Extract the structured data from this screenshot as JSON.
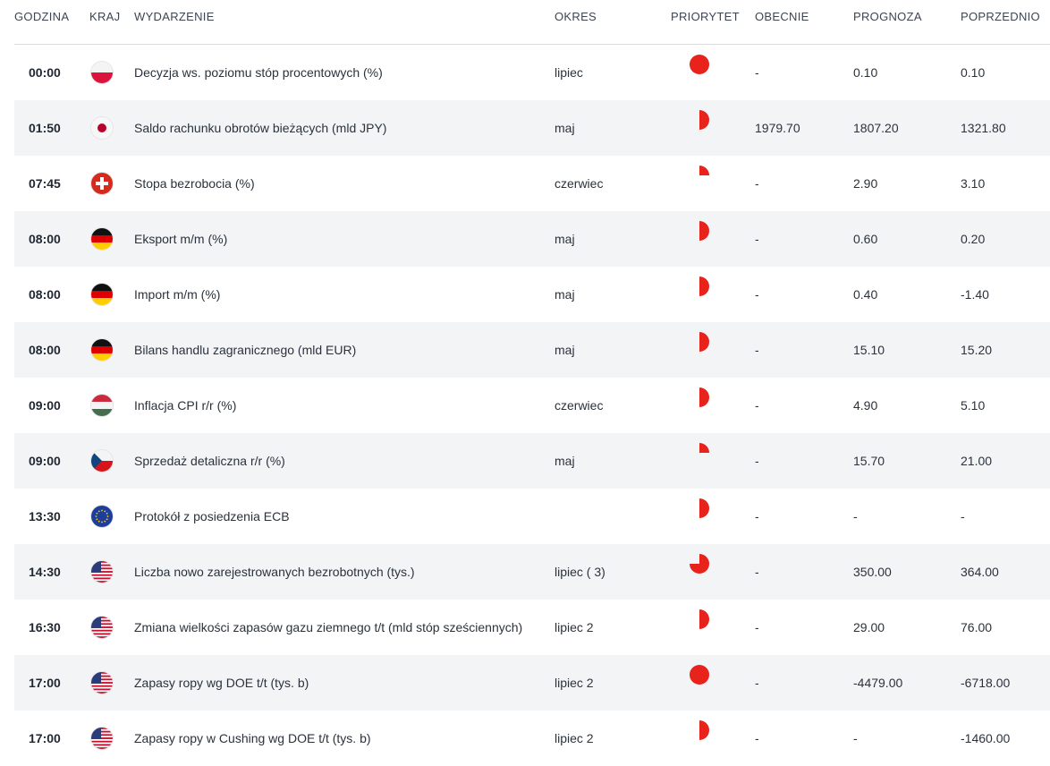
{
  "headers": {
    "time": "GODZINA",
    "country": "KRAJ",
    "event": "WYDARZENIE",
    "period": "OKRES",
    "priority": "PRIORYTET",
    "actual": "OBECNIE",
    "forecast": "PROGNOZA",
    "previous": "POPRZEDNIO"
  },
  "colors": {
    "priority": "#e8231c",
    "row_alt_bg": "#f3f4f6",
    "divider": "#d8dce2"
  },
  "rows": [
    {
      "time": "00:00",
      "country": "flag-poland-icon",
      "event": "Decyzja ws. poziomu stóp procentowych (%)",
      "period": "lipiec",
      "priority": "full",
      "actual": "-",
      "forecast": "0.10",
      "previous": "0.10"
    },
    {
      "time": "01:50",
      "country": "flag-japan-icon",
      "event": "Saldo rachunku obrotów bieżących (mld JPY)",
      "period": "maj",
      "priority": "half",
      "actual": "1979.70",
      "forecast": "1807.20",
      "previous": "1321.80"
    },
    {
      "time": "07:45",
      "country": "flag-switzerland-icon",
      "event": "Stopa bezrobocia (%)",
      "period": "czerwiec",
      "priority": "quarter",
      "actual": "-",
      "forecast": "2.90",
      "previous": "3.10"
    },
    {
      "time": "08:00",
      "country": "flag-germany-icon",
      "event": "Eksport m/m (%)",
      "period": "maj",
      "priority": "half",
      "actual": "-",
      "forecast": "0.60",
      "previous": "0.20"
    },
    {
      "time": "08:00",
      "country": "flag-germany-icon",
      "event": "Import m/m (%)",
      "period": "maj",
      "priority": "half",
      "actual": "-",
      "forecast": "0.40",
      "previous": "-1.40"
    },
    {
      "time": "08:00",
      "country": "flag-germany-icon",
      "event": "Bilans handlu zagranicznego (mld EUR)",
      "period": "maj",
      "priority": "half",
      "actual": "-",
      "forecast": "15.10",
      "previous": "15.20"
    },
    {
      "time": "09:00",
      "country": "flag-hungary-icon",
      "event": "Inflacja CPI r/r (%)",
      "period": "czerwiec",
      "priority": "half",
      "actual": "-",
      "forecast": "4.90",
      "previous": "5.10"
    },
    {
      "time": "09:00",
      "country": "flag-czechia-icon",
      "event": "Sprzedaż detaliczna r/r (%)",
      "period": "maj",
      "priority": "quarter",
      "actual": "-",
      "forecast": "15.70",
      "previous": "21.00"
    },
    {
      "time": "13:30",
      "country": "flag-eu-icon",
      "event": "Protokół z posiedzenia ECB",
      "period": "",
      "priority": "half",
      "actual": "-",
      "forecast": "-",
      "previous": "-"
    },
    {
      "time": "14:30",
      "country": "flag-usa-icon",
      "event": "Liczba nowo zarejestrowanych bezrobotnych (tys.)",
      "period": "lipiec ( 3)",
      "priority": "three-quarter",
      "actual": "-",
      "forecast": "350.00",
      "previous": "364.00"
    },
    {
      "time": "16:30",
      "country": "flag-usa-icon",
      "event": "Zmiana wielkości zapasów gazu ziemnego t/t (mld stóp sześciennych)",
      "period": "lipiec 2",
      "priority": "half",
      "actual": "-",
      "forecast": "29.00",
      "previous": "76.00"
    },
    {
      "time": "17:00",
      "country": "flag-usa-icon",
      "event": "Zapasy ropy wg DOE t/t (tys. b)",
      "period": "lipiec 2",
      "priority": "full",
      "actual": "-",
      "forecast": "-4479.00",
      "previous": "-6718.00"
    },
    {
      "time": "17:00",
      "country": "flag-usa-icon",
      "event": "Zapasy ropy w Cushing wg DOE t/t (tys. b)",
      "period": "lipiec 2",
      "priority": "half",
      "actual": "-",
      "forecast": "-",
      "previous": "-1460.00"
    }
  ]
}
